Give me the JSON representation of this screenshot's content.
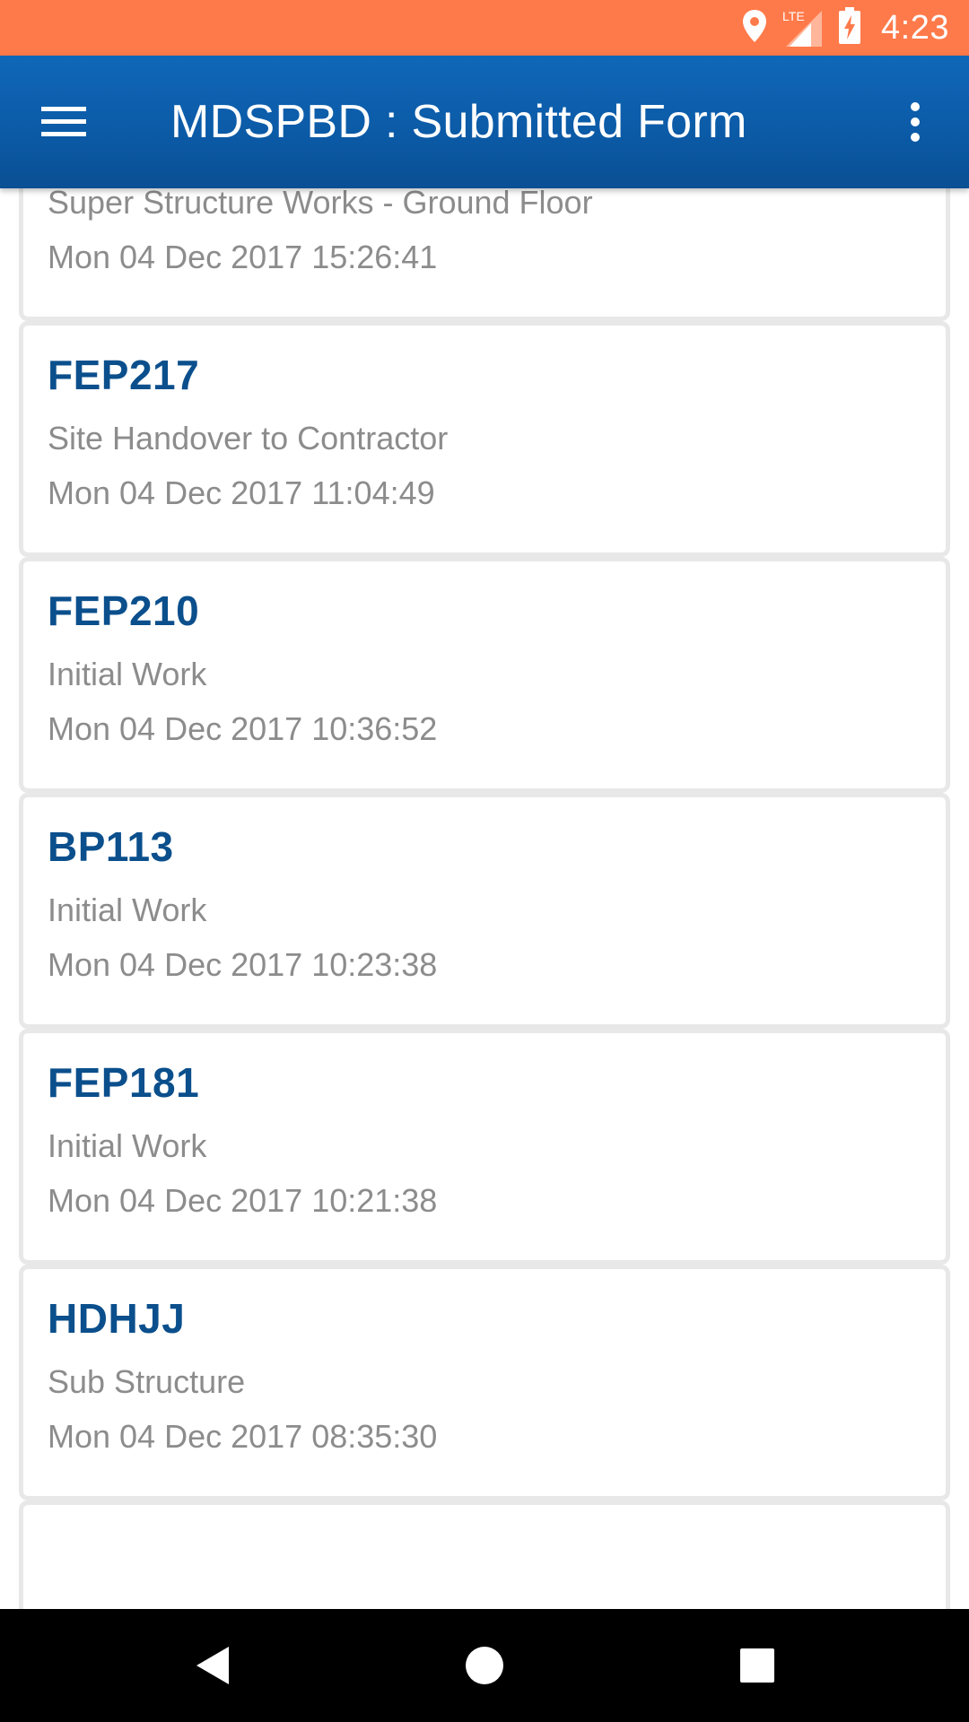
{
  "status_bar": {
    "time": "4:23",
    "network_label": "LTE",
    "icons": [
      "location-icon",
      "signal-icon",
      "battery-charging-icon"
    ]
  },
  "app_bar": {
    "title": "MDSPBD : Submitted Form",
    "menu_icon": "hamburger-menu-icon",
    "overflow_icon": "more-vert-icon"
  },
  "forms": [
    {
      "code": "",
      "name": "Super Structure Works - Ground Floor",
      "date": "Mon 04 Dec 2017 15:26:41"
    },
    {
      "code": "FEP217",
      "name": "Site Handover to Contractor",
      "date": "Mon 04 Dec 2017 11:04:49"
    },
    {
      "code": "FEP210",
      "name": "Initial Work",
      "date": "Mon 04 Dec 2017 10:36:52"
    },
    {
      "code": "BP113",
      "name": "Initial Work",
      "date": "Mon 04 Dec 2017 10:23:38"
    },
    {
      "code": "FEP181",
      "name": "Initial Work",
      "date": "Mon 04 Dec 2017 10:21:38"
    },
    {
      "code": "HDHJJ",
      "name": "Sub Structure",
      "date": "Mon 04 Dec 2017 08:35:30"
    },
    {
      "code": "",
      "name": "",
      "date": ""
    }
  ],
  "nav_bar": {
    "icons": [
      "back-icon",
      "home-icon",
      "recents-icon"
    ]
  },
  "colors": {
    "status_bar": "#ff7a4a",
    "app_bar": "#0b5aa6",
    "card_title": "#0b4f8c",
    "secondary_text": "#8c8c8c"
  }
}
